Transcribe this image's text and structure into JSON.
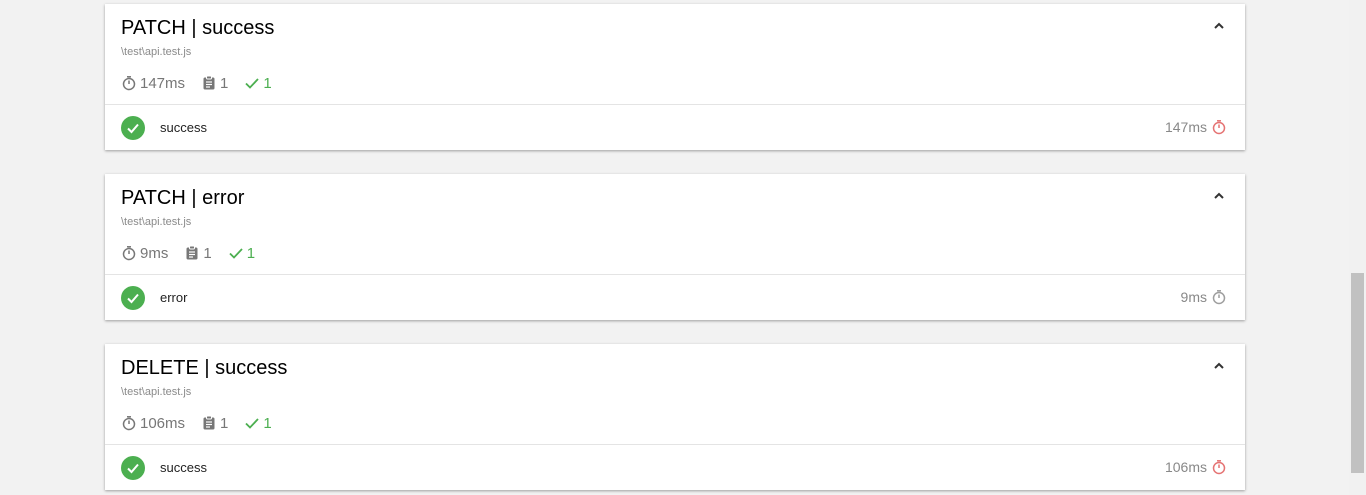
{
  "suites": [
    {
      "title": "PATCH | success",
      "file": "\\test\\api.test.js",
      "duration": "147ms",
      "tests": "1",
      "passes": "1",
      "test": {
        "name": "success",
        "duration": "147ms",
        "speed": "medium"
      }
    },
    {
      "title": "PATCH | error",
      "file": "\\test\\api.test.js",
      "duration": "9ms",
      "tests": "1",
      "passes": "1",
      "test": {
        "name": "error",
        "duration": "9ms",
        "speed": "fast"
      }
    },
    {
      "title": "DELETE | success",
      "file": "\\test\\api.test.js",
      "duration": "106ms",
      "tests": "1",
      "passes": "1",
      "test": {
        "name": "success",
        "duration": "106ms",
        "speed": "medium"
      }
    }
  ],
  "colors": {
    "pass": "#4caf50",
    "slow_timer": "#e57373",
    "fast_timer": "#9e9e9e"
  },
  "icons": {
    "collapse": "chevron-up-icon",
    "duration": "timer-icon",
    "tests": "clipboard-icon",
    "passes": "check-icon",
    "status": "check-circle-icon"
  }
}
